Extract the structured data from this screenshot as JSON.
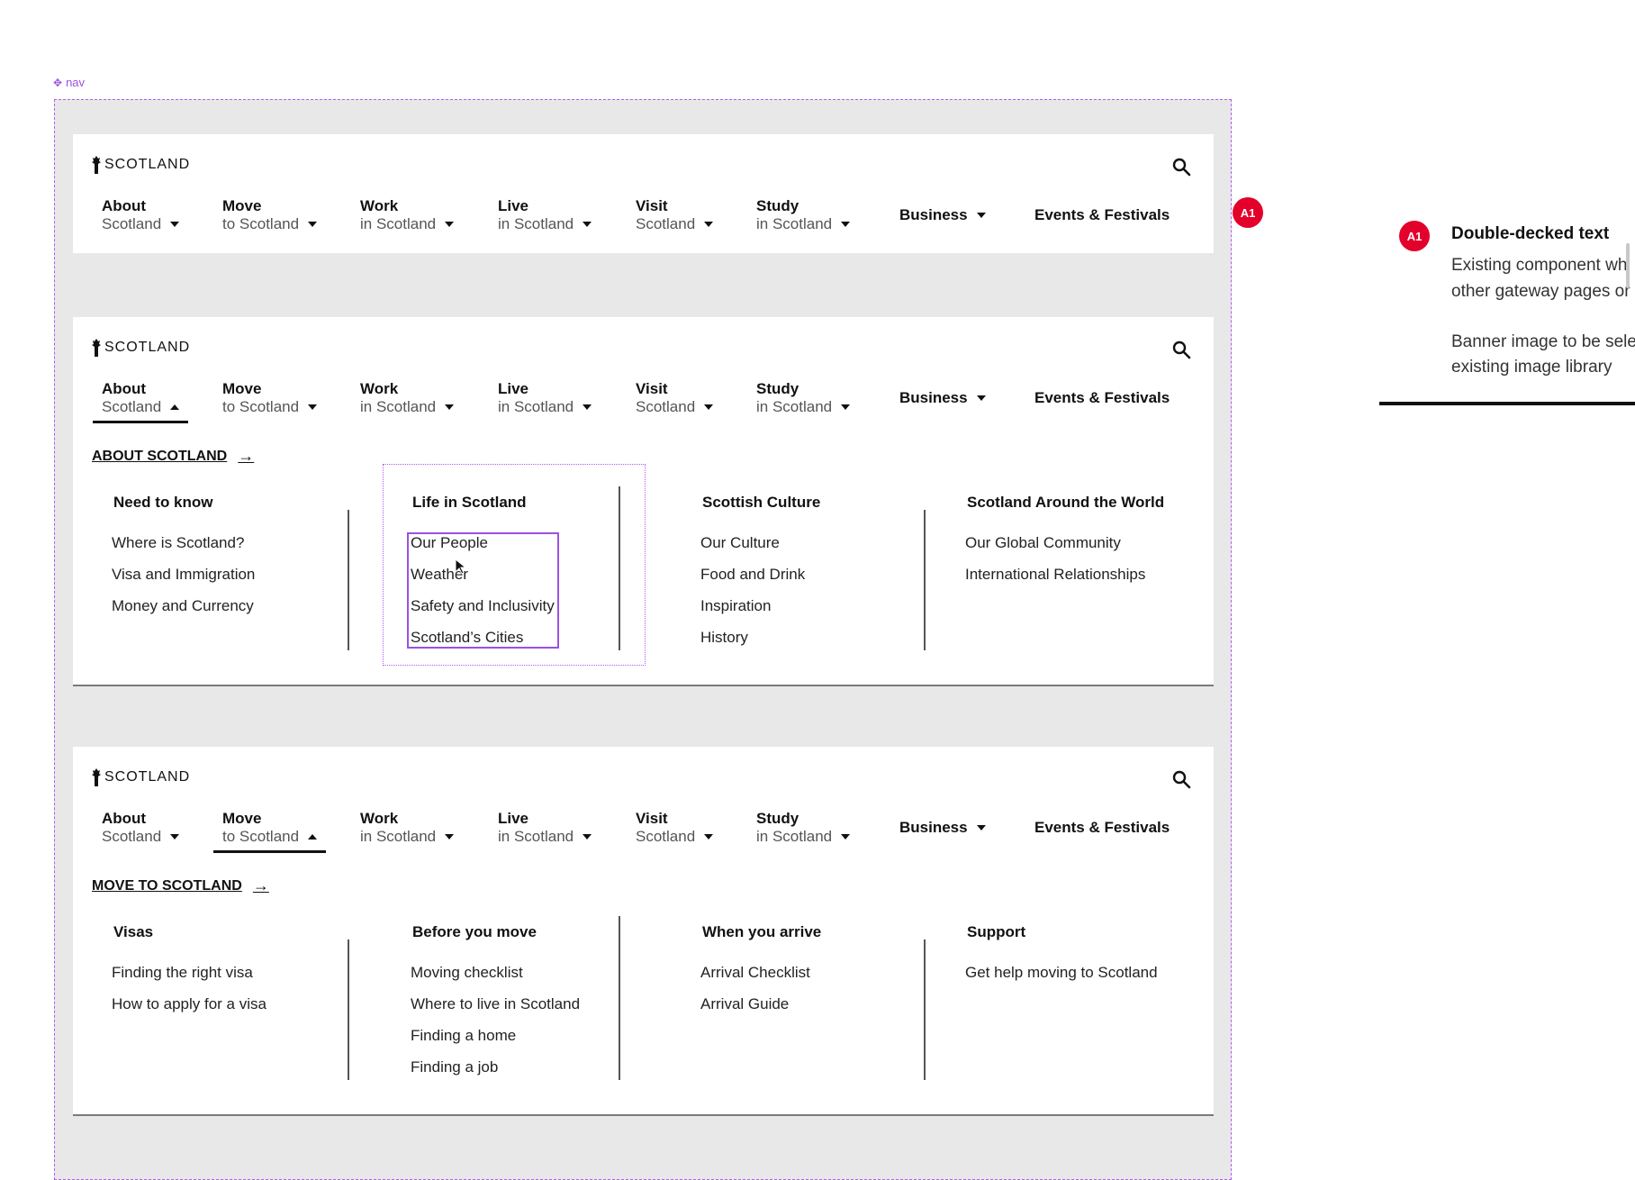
{
  "canvas": {
    "frame_label": "nav",
    "accent_color": "#9b51e0",
    "badge_color": "#e3002b"
  },
  "brand": {
    "logo_text": "SCOTLAND"
  },
  "nav_items": [
    {
      "line1": "About",
      "line2": "Scotland"
    },
    {
      "line1": "Move",
      "line2": "to Scotland"
    },
    {
      "line1": "Work",
      "line2": "in Scotland"
    },
    {
      "line1": "Live",
      "line2": "in Scotland"
    },
    {
      "line1": "Visit",
      "line2": "Scotland"
    },
    {
      "line1": "Study",
      "line2": "in Scotland"
    },
    {
      "line1": "Business"
    },
    {
      "line1": "Events & Festivals"
    }
  ],
  "panels": {
    "about": {
      "heading": "ABOUT SCOTLAND",
      "columns": [
        {
          "title": "Need to know",
          "links": [
            "Where is Scotland?",
            "Visa and Immigration",
            "Money and Currency"
          ]
        },
        {
          "title": "Life in Scotland",
          "links": [
            "Our People",
            "Weather",
            "Safety and Inclusivity",
            "Scotland’s Cities"
          ]
        },
        {
          "title": "Scottish Culture",
          "links": [
            "Our Culture",
            "Food and Drink",
            "Inspiration",
            "History"
          ]
        },
        {
          "title": "Scotland Around the World",
          "links": [
            "Our Global Community",
            "International Relationships"
          ]
        }
      ]
    },
    "move": {
      "heading": "MOVE TO SCOTLAND",
      "columns": [
        {
          "title": "Visas",
          "links": [
            "Finding the right visa",
            "How to apply for a visa"
          ]
        },
        {
          "title": "Before you move",
          "links": [
            "Moving checklist",
            "Where to live in Scotland",
            "Finding a home",
            "Finding a job"
          ]
        },
        {
          "title": "When you arrive",
          "links": [
            "Arrival Checklist",
            "Arrival Guide"
          ]
        },
        {
          "title": "Support",
          "links": [
            "Get help moving to Scotland"
          ]
        }
      ]
    }
  },
  "annotation": {
    "badge": "A1",
    "title": "Double-decked text",
    "lines": [
      "Existing component wh",
      "other gateway pages or",
      "Banner image to be sele",
      "existing image library"
    ]
  }
}
